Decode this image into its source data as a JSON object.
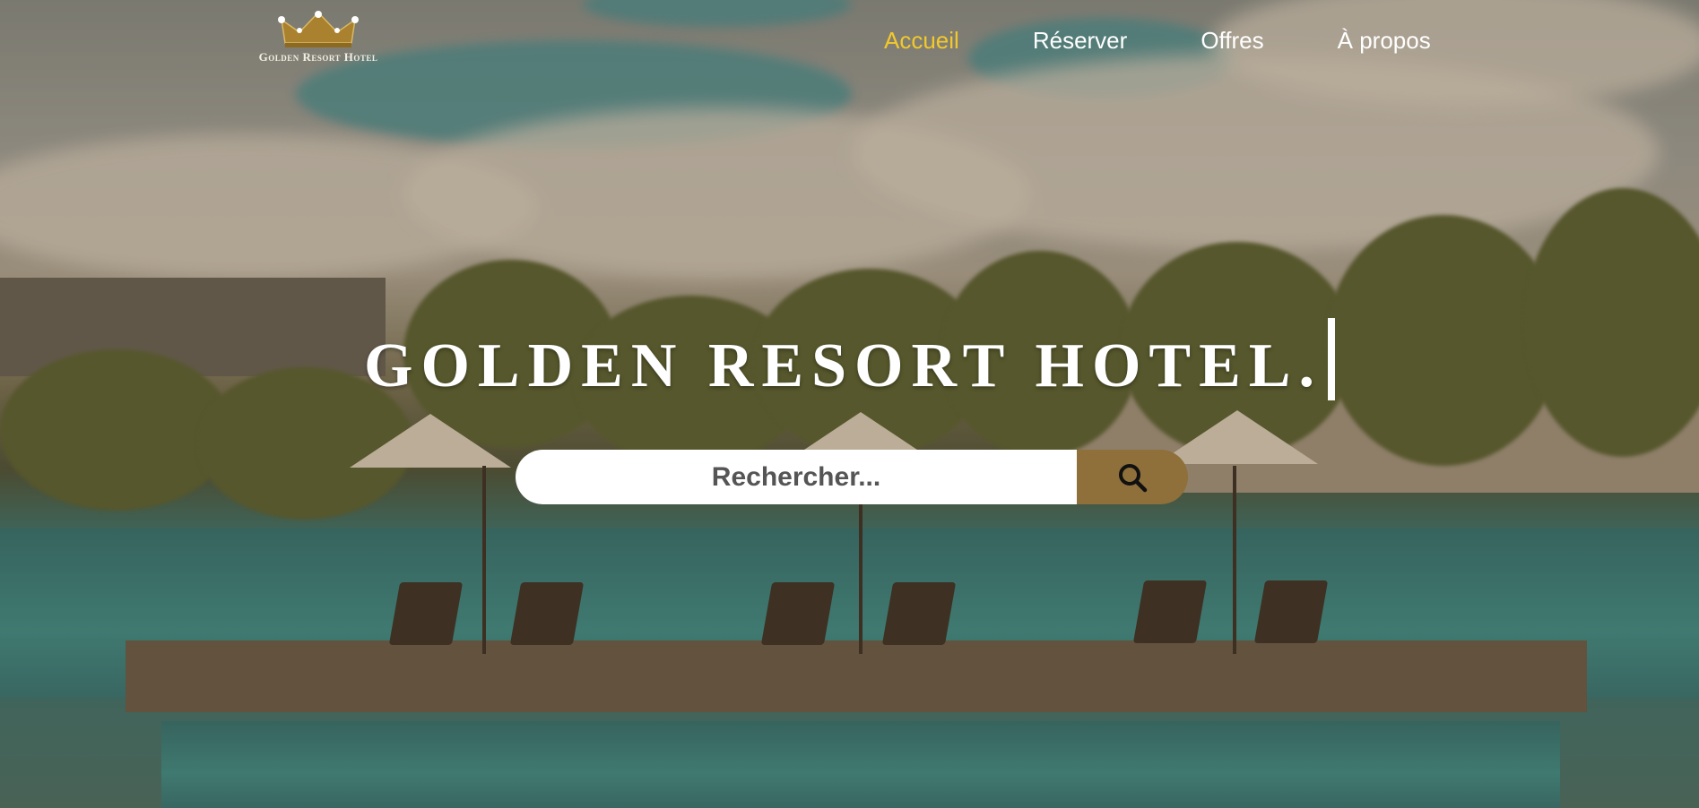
{
  "brand": {
    "name": "Golden Resort Hotel",
    "logo_icon": "crown-icon"
  },
  "nav": {
    "items": [
      {
        "label": "Accueil",
        "active": true
      },
      {
        "label": "Réserver",
        "active": false
      },
      {
        "label": "Offres",
        "active": false
      },
      {
        "label": "À propos",
        "active": false
      }
    ],
    "active_color": "#f3c82c",
    "color": "#ffffff"
  },
  "hero": {
    "title": "GOLDEN RESORT HOTEL."
  },
  "search": {
    "placeholder": "Rechercher...",
    "value": "",
    "button_icon": "search-icon",
    "button_color": "#8f6f3a"
  }
}
